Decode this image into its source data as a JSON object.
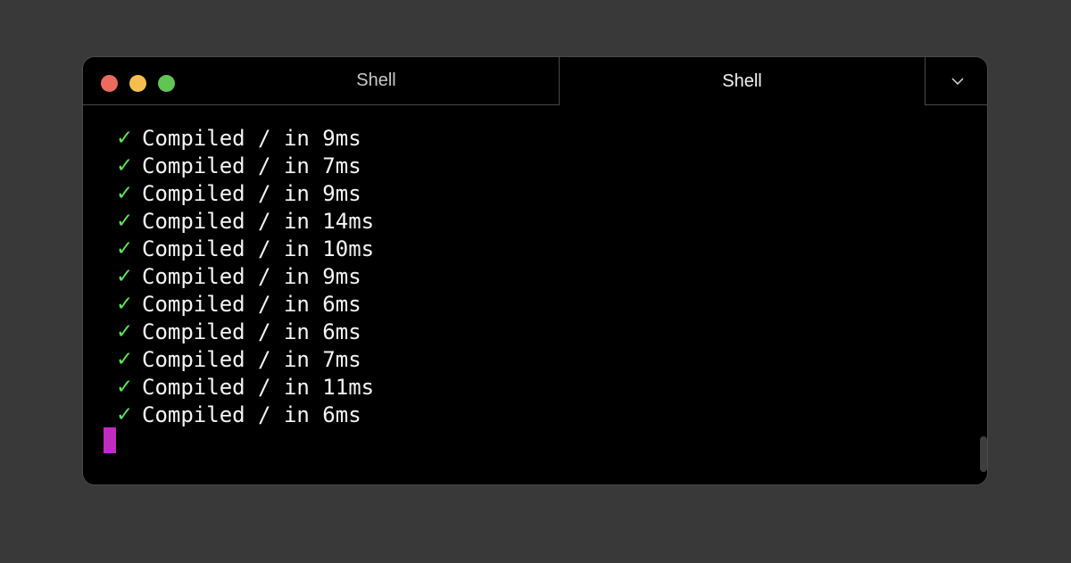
{
  "window": {
    "traffic_lights": {
      "close": "#ed6a5e",
      "minimize": "#f5bf4f",
      "maximize": "#61c554"
    },
    "tabs": [
      {
        "label": "Shell",
        "active": false
      },
      {
        "label": "Shell",
        "active": true
      }
    ],
    "tab_menu_icon": "chevron-down-icon"
  },
  "terminal": {
    "check_icon": "✓",
    "check_color": "#5ee35a",
    "cursor_color": "#c02cc0",
    "lines": [
      {
        "text": "Compiled / in 9ms"
      },
      {
        "text": "Compiled / in 7ms"
      },
      {
        "text": "Compiled / in 9ms"
      },
      {
        "text": "Compiled / in 14ms"
      },
      {
        "text": "Compiled / in 10ms"
      },
      {
        "text": "Compiled / in 9ms"
      },
      {
        "text": "Compiled / in 6ms"
      },
      {
        "text": "Compiled / in 6ms"
      },
      {
        "text": "Compiled / in 7ms"
      },
      {
        "text": "Compiled / in 11ms"
      },
      {
        "text": "Compiled / in 6ms"
      }
    ]
  }
}
